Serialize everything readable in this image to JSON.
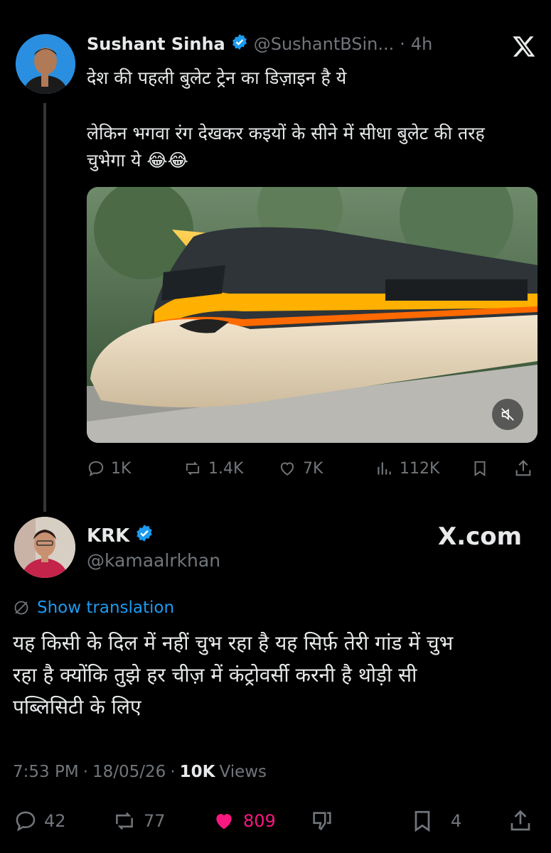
{
  "quoted_tweet": {
    "author_name": "Sushant Sinha",
    "handle": "@SushantBSin...",
    "separator": "·",
    "time": "4h",
    "line1": "देश की पहली बुलेट ट्रेन का डिज़ाइन है ये",
    "line2": "लेकिन भगवा रंग देखकर कइयों के सीने में सीधा बुलेट की तरह",
    "line3": "चुभेगा ये 😂😂",
    "stats": {
      "replies": "1K",
      "retweets": "1.4K",
      "likes": "7K",
      "views": "112K"
    },
    "icons": {
      "close": "x-logo-icon",
      "mute": "muted-speaker-icon"
    }
  },
  "main_tweet": {
    "author_name": "KRK",
    "handle": "@kamaalrkhan",
    "watermark": "X.com",
    "show_translation": "Show translation",
    "text_line1": "यह किसी के दिल में नहीं चुभ रहा है यह सिर्फ़ तेरी गांड में चुभ",
    "text_line2": "रहा है क्योंकि तुझे हर चीज़ में कंट्रोवर्सी करनी है थोड़ी सी",
    "text_line3": "पब्लिसिटी के लिए",
    "time": "7:53 PM",
    "date": "18/05/26",
    "sep": "·",
    "views_count": "10K",
    "views_label": "Views",
    "stats": {
      "replies": "42",
      "retweets": "77",
      "likes": "809",
      "bookmarks": "4"
    }
  },
  "colors": {
    "background": "#000000",
    "text": "#e7e9ea",
    "muted": "#71767b",
    "link": "#1d9bf0",
    "like": "#f91880",
    "verified": "#1d9bf0"
  }
}
